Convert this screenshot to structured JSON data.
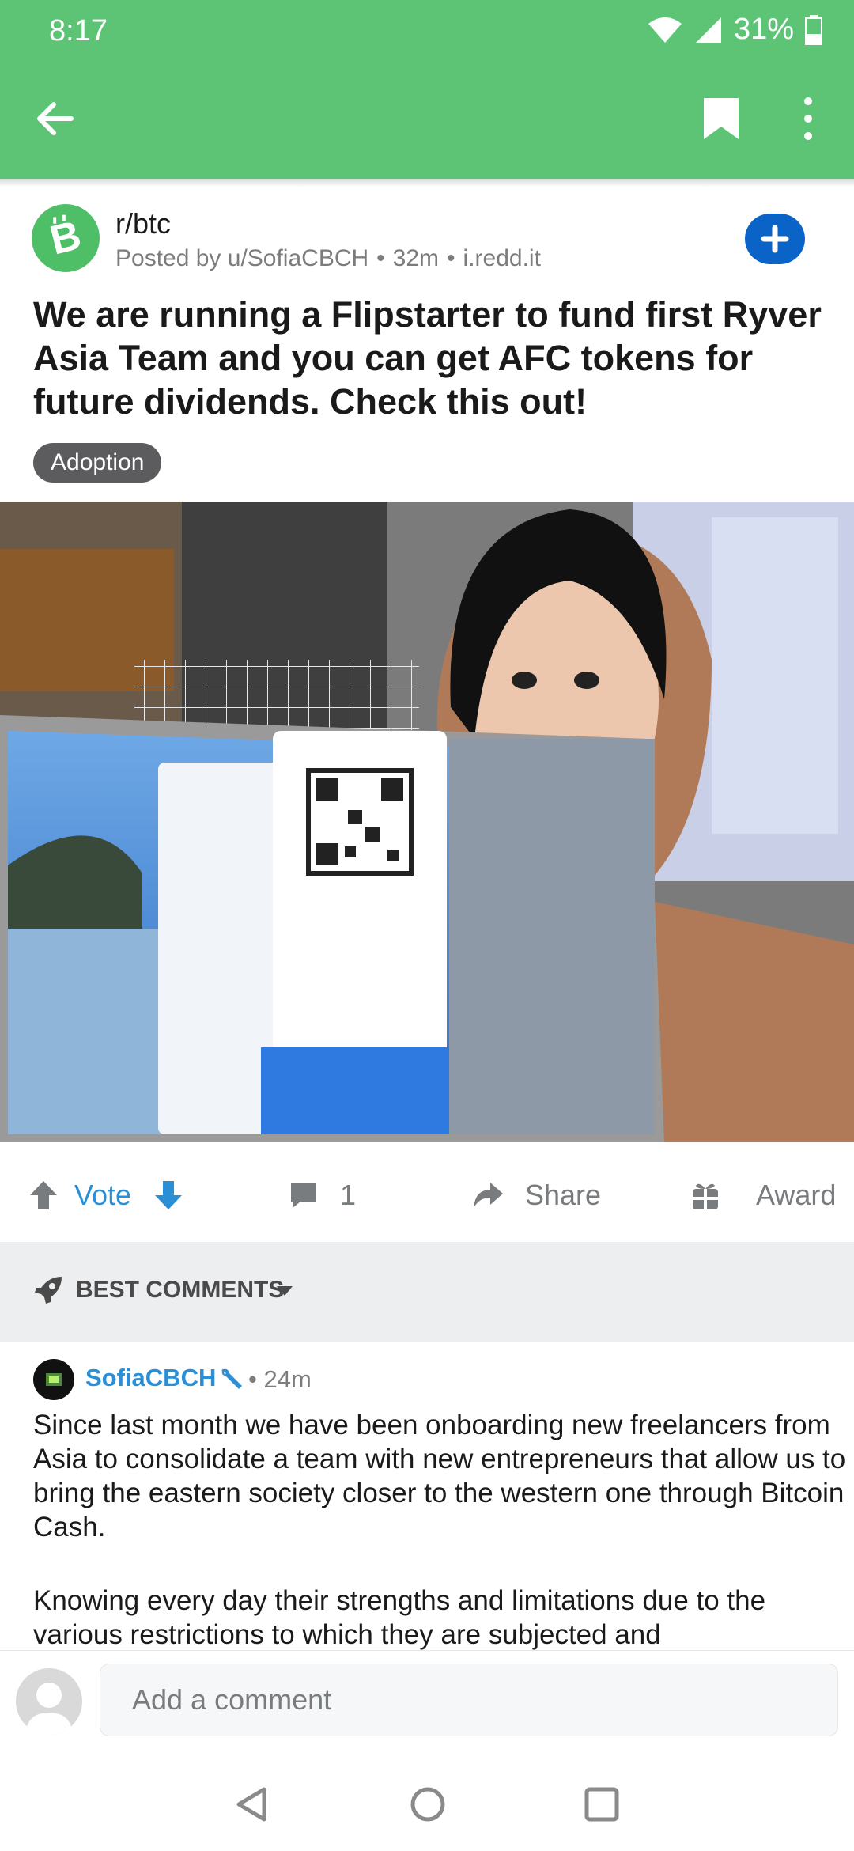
{
  "status_bar": {
    "time": "8:17",
    "battery": "31%"
  },
  "header": {
    "background": "#5dc476"
  },
  "post": {
    "subreddit": "r/btc",
    "posted_by": "Posted by u/SofiaCBCH",
    "age": "32m",
    "domain": "i.redd.it",
    "separator": "•",
    "title": "We are running a Flipstarter to fund first Ryver Asia Team and you can get AFC tokens for future dividends. Check this out!",
    "flair": "Adoption"
  },
  "actions": {
    "vote_label": "Vote",
    "comment_count": "1",
    "share_label": "Share",
    "award_label": "Award"
  },
  "sort": {
    "label": "BEST COMMENTS"
  },
  "comment": {
    "author": "SofiaCBCH",
    "time": "• 24m",
    "paragraph_1": "Since last month we have been onboarding new freelancers from Asia to consolidate a team with new entrepreneurs that allow us to bring the eastern society closer to the western one through Bitcoin Cash.",
    "paragraph_2": "Knowing every day their strengths and limitations due to the various restrictions to which they are subjected and"
  },
  "compose": {
    "placeholder": "Add a comment"
  },
  "colors": {
    "accent_blue": "#0a64c8",
    "link_blue": "#2b8fd6",
    "flair_bg": "#5c5c5e"
  }
}
